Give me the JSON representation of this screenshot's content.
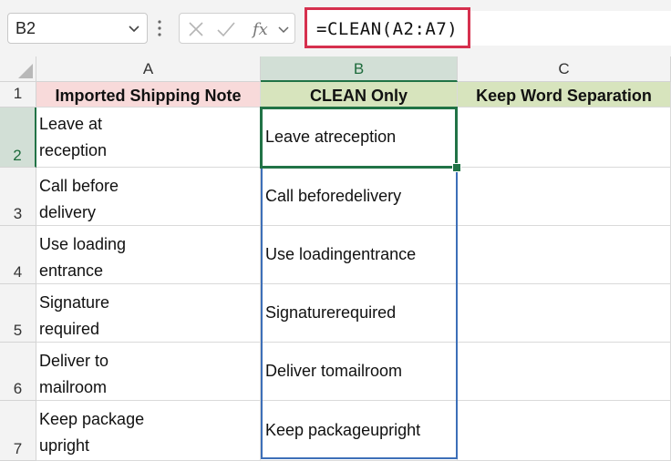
{
  "formula_bar": {
    "name_box": "B2",
    "fx_label": "fx",
    "formula": "=CLEAN(A2:A7)"
  },
  "columns": [
    "A",
    "B",
    "C"
  ],
  "rows": [
    "1",
    "2",
    "3",
    "4",
    "5",
    "6",
    "7"
  ],
  "headers": {
    "a": "Imported Shipping Note",
    "b": "CLEAN Only",
    "c": "Keep Word Separation"
  },
  "data_rows": [
    {
      "a": "Leave at\nreception",
      "b": "Leave atreception",
      "c": ""
    },
    {
      "a": "Call before\ndelivery",
      "b": "Call beforedelivery",
      "c": ""
    },
    {
      "a": "Use loading\nentrance",
      "b": "Use loadingentrance",
      "c": ""
    },
    {
      "a": "Signature\nrequired",
      "b": "Signaturerequired",
      "c": ""
    },
    {
      "a": "Deliver to\nmailroom",
      "b": "Deliver tomailroom",
      "c": ""
    },
    {
      "a": "Keep package\nupright",
      "b": "Keep packageupright",
      "c": ""
    }
  ],
  "colors": {
    "header_a": "#f8dada",
    "header_bc": "#d7e4bd",
    "formula_highlight": "#d6304e",
    "selection": "#217346",
    "range_border": "#3d6fb8"
  }
}
